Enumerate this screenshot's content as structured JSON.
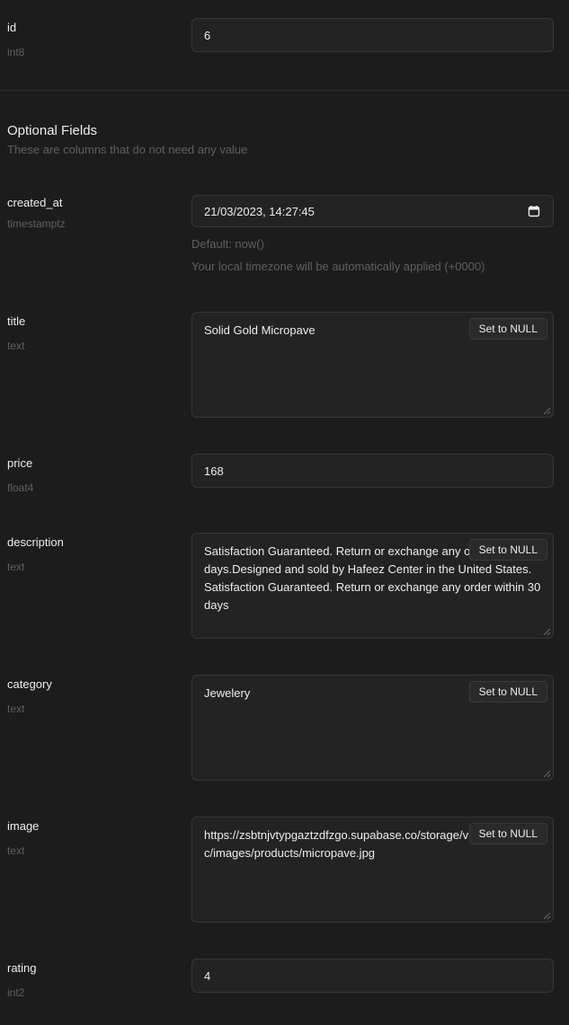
{
  "fields": {
    "id": {
      "name": "id",
      "type": "int8",
      "value": "6"
    },
    "created_at": {
      "name": "created_at",
      "type": "timestamptz",
      "value": "21/03/2023, 14:27:45",
      "default_hint": "Default: now()",
      "timezone_hint": "Your local timezone will be automatically applied (+0000)"
    },
    "title": {
      "name": "title",
      "type": "text",
      "value": "Solid Gold Micropave"
    },
    "price": {
      "name": "price",
      "type": "float4",
      "value": "168"
    },
    "description": {
      "name": "description",
      "type": "text",
      "value": "Satisfaction Guaranteed. Return or exchange any order within 30 days.Designed and sold by Hafeez Center in the United States. Satisfaction Guaranteed. Return or exchange any order within 30 days"
    },
    "category": {
      "name": "category",
      "type": "text",
      "value": "Jewelery"
    },
    "image": {
      "name": "image",
      "type": "text",
      "value": "https://zsbtnjvtypgaztzdfzgo.supabase.co/storage/v1/object/public/images/products/micropave.jpg"
    },
    "rating": {
      "name": "rating",
      "type": "int2",
      "value": "4"
    }
  },
  "optional_section": {
    "title": "Optional Fields",
    "subtitle": "These are columns that do not need any value"
  },
  "set_null_label": "Set to NULL",
  "icons": {
    "calendar": "calendar-icon"
  },
  "colors": {
    "background": "#1c1c1c",
    "input_bg": "#232323",
    "border": "#363636",
    "muted_text": "#5f5f5f"
  }
}
